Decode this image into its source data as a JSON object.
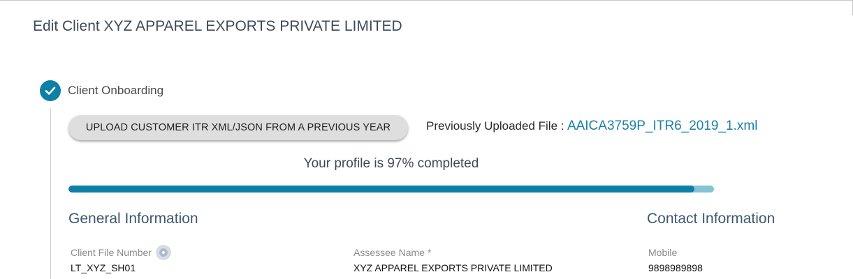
{
  "page": {
    "title": "Edit Client XYZ APPAREL EXPORTS PRIVATE LIMITED"
  },
  "step": {
    "label": "Client Onboarding",
    "icon": "check-circle-icon",
    "status": "completed"
  },
  "upload": {
    "button_label": "UPLOAD CUSTOMER ITR XML/JSON FROM A PREVIOUS YEAR",
    "previous_label": "Previously Uploaded File :",
    "previous_file": "AAICA3759P_ITR6_2019_1.xml"
  },
  "profile": {
    "progress_text": "Your profile is 97% completed",
    "percent": 97
  },
  "general": {
    "title": "General Information",
    "client_file_number": {
      "label": "Client File Number",
      "value": "LT_XYZ_SH01"
    },
    "assessee_name": {
      "label": "Assessee Name *",
      "value": "XYZ APPAREL EXPORTS PRIVATE LIMITED"
    }
  },
  "contact": {
    "title": "Contact Information",
    "mobile": {
      "label": "Mobile",
      "value": "9898989898"
    }
  },
  "colors": {
    "accent": "#0e7fa6",
    "progress_track": "#85c3d3",
    "link": "#1a80a8",
    "heading": "#3e5870"
  }
}
